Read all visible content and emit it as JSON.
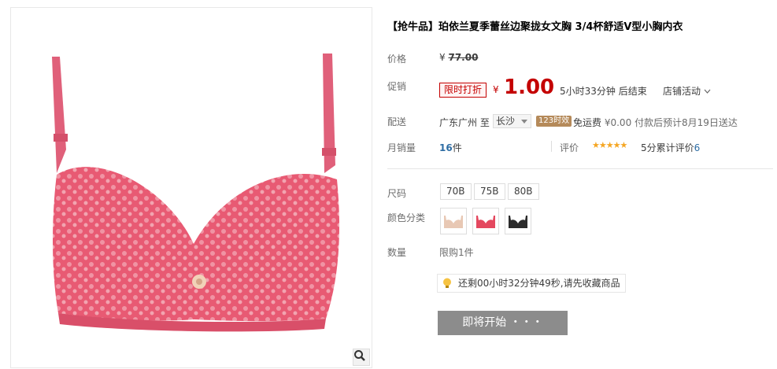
{
  "product": {
    "title": "【抢牛品】珀依兰夏季蕾丝边聚拢女文胸 3/4杯舒适V型小胸内衣",
    "image_alt": "pink lace bra"
  },
  "price": {
    "label": "价格",
    "currency": "¥",
    "original": "77.00"
  },
  "promotion": {
    "label": "促销",
    "tag": "限时打折",
    "currency": "¥",
    "price": "1.00",
    "countdown": "5小时33分钟  后结束",
    "shop_activity": "店铺活动"
  },
  "shipping": {
    "label": "配送",
    "from": "广东广州  至",
    "to": "长沙",
    "time_badge": "123时效",
    "free_shipping": "免运费",
    "fee": "¥0.00",
    "eta": "付款后预计8月19日送达"
  },
  "sales": {
    "label": "月销量",
    "count": "16",
    "unit": "件",
    "review_label": "评价",
    "stars": "★★★★★",
    "score": "5分",
    "reviews_text": "累计评价",
    "reviews_count": "6"
  },
  "options": {
    "size_label": "尺码",
    "sizes": [
      "70B",
      "75B",
      "80B"
    ],
    "color_label": "颜色分类",
    "quantity_label": "数量",
    "quantity_limit": "限购1件"
  },
  "reminder": {
    "text": "还剩00小时32分钟49秒,请先收藏商品"
  },
  "buttons": {
    "start": "即将开始 ・・・"
  },
  "colors": {
    "accent_red": "#c40000",
    "link_blue": "#2e6da4",
    "button_gray": "#8c8c8c",
    "bra_pink": "#e85a73"
  },
  "icons": {
    "zoom": "magnifier-icon",
    "reminder": "lightbulb-icon",
    "dropdown": "chevron-down-icon"
  }
}
